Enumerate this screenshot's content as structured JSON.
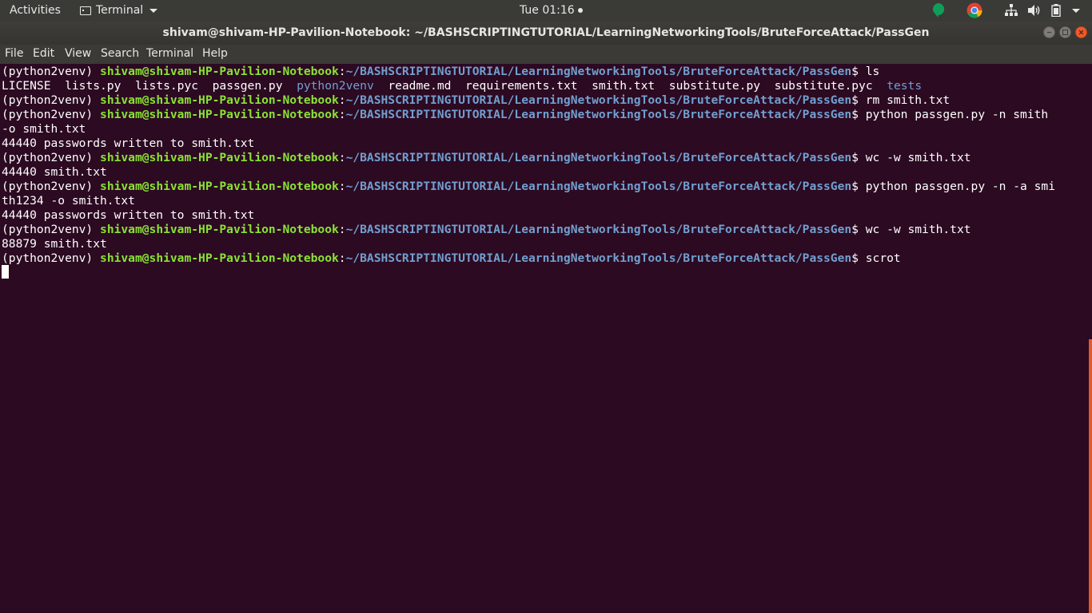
{
  "topbar": {
    "activities": "Activities",
    "app_name": "Terminal",
    "clock": "Tue 01:16"
  },
  "window": {
    "title": "shivam@shivam-HP-Pavilion-Notebook: ~/BASHSCRIPTINGTUTORIAL/LearningNetworkingTools/BruteForceAttack/PassGen"
  },
  "menu": [
    "File",
    "Edit",
    "View",
    "Search",
    "Terminal",
    "Help"
  ],
  "terminal": {
    "env": "(python2venv)",
    "user_host": "shivam@shivam-HP-Pavilion-Notebook",
    "path": "~/BASHSCRIPTINGTUTORIAL/LearningNetworkingTools/BruteForceAttack/PassGen",
    "commands": [
      "ls",
      "rm smith.txt",
      "python passgen.py -n smith",
      "-o smith.txt",
      "wc -w smith.txt",
      "python passgen.py -n -a smi",
      "th1234 -o smith.txt",
      "wc -w smith.txt",
      "scrot"
    ],
    "ls_output": [
      "LICENSE",
      "lists.py",
      "lists.pyc",
      "passgen.py",
      "python2venv",
      "readme.md",
      "requirements.txt",
      "smith.txt",
      "substitute.py",
      "substitute.pyc",
      "tests"
    ],
    "outputs": [
      "44440 passwords written to smith.txt",
      "44440 smith.txt",
      "44440 passwords written to smith.txt",
      "88879 smith.txt"
    ]
  },
  "colors": {
    "terminal_bg": "#2c0a22",
    "user_green": "#8ae234",
    "path_blue": "#729fcf",
    "close_orange": "#ef5b2e"
  }
}
